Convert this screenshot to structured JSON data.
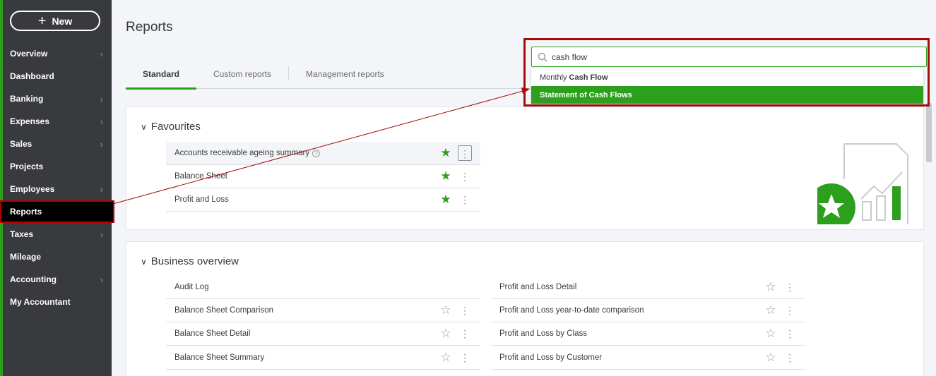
{
  "sidebar": {
    "new_label": "New",
    "items": [
      {
        "label": "Overview",
        "chev": "›"
      },
      {
        "label": "Dashboard",
        "chev": ""
      },
      {
        "label": "Banking",
        "chev": "›"
      },
      {
        "label": "Expenses",
        "chev": "›"
      },
      {
        "label": "Sales",
        "chev": "›"
      },
      {
        "label": "Projects",
        "chev": ""
      },
      {
        "label": "Employees",
        "chev": "›"
      },
      {
        "label": "Reports",
        "chev": ""
      },
      {
        "label": "Taxes",
        "chev": "›"
      },
      {
        "label": "Mileage",
        "chev": ""
      },
      {
        "label": "Accounting",
        "chev": "›"
      },
      {
        "label": "My Accountant",
        "chev": ""
      }
    ]
  },
  "page": {
    "title": "Reports"
  },
  "tabs": [
    "Standard",
    "Custom reports",
    "Management reports"
  ],
  "search": {
    "value": "cash flow",
    "suggestions": [
      {
        "prefix": "Monthly",
        "bold": "Cash Flow"
      },
      {
        "prefix": "",
        "bold": "Statement of Cash Flows"
      }
    ]
  },
  "favourites": {
    "title": "Favourites",
    "rows": [
      "Accounts receivable ageing summary",
      "Balance Sheet",
      "Profit and Loss"
    ]
  },
  "business_overview": {
    "title": "Business overview",
    "left": [
      "Audit Log",
      "Balance Sheet Comparison",
      "Balance Sheet Detail",
      "Balance Sheet Summary"
    ],
    "right": [
      "Profit and Loss Detail",
      "Profit and Loss year-to-date comparison",
      "Profit and Loss by Class",
      "Profit and Loss by Customer"
    ]
  },
  "icons": {
    "star_filled": "★",
    "star_empty": "☆",
    "more": "⋮",
    "caret": "∨",
    "help": "?"
  },
  "colors": {
    "brand_green": "#2ca01c",
    "sidebar_bg": "#393a3d",
    "annotation_red": "#a50d0d"
  }
}
